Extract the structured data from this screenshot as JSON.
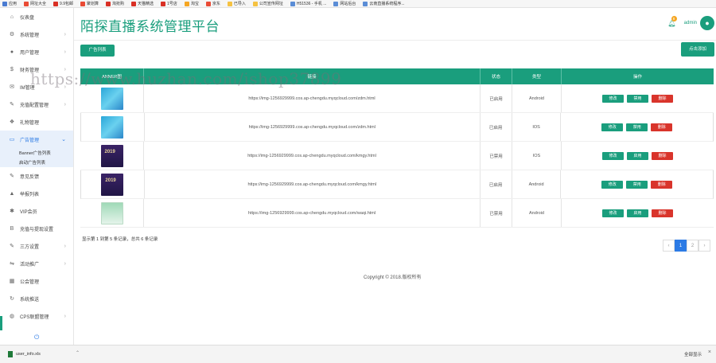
{
  "bookmarks": [
    {
      "label": "应用",
      "color": "#4a7bd1"
    },
    {
      "label": "网址大全",
      "color": "#e94b35"
    },
    {
      "label": "9.9包邮",
      "color": "#d93025"
    },
    {
      "label": "聚划算",
      "color": "#e94b35"
    },
    {
      "label": "淘抢购",
      "color": "#d93025"
    },
    {
      "label": "天猫精选",
      "color": "#d93025"
    },
    {
      "label": "1号店",
      "color": "#d93025"
    },
    {
      "label": "淘宝",
      "color": "#f5a623"
    },
    {
      "label": "京东",
      "color": "#e94b35"
    },
    {
      "label": "已导入",
      "color": "#f5c242"
    },
    {
      "label": "公司宣传网址",
      "color": "#f5c242"
    },
    {
      "label": "H51536 - 手机 ...",
      "color": "#5b8dd6"
    },
    {
      "label": "网站后台",
      "color": "#5b8dd6"
    },
    {
      "label": "云南直播系统程序...",
      "color": "#5b8dd6"
    }
  ],
  "sidebar": {
    "items": [
      {
        "label": "仪表盘",
        "icon": "home-icon",
        "glyph": "⌂",
        "chev": ""
      },
      {
        "label": "系统管理",
        "icon": "sliders-icon",
        "glyph": "⚙",
        "chev": "›"
      },
      {
        "label": "用户管理",
        "icon": "user-icon",
        "glyph": "●",
        "chev": "›"
      },
      {
        "label": "财务管理",
        "icon": "dollar-icon",
        "glyph": "$",
        "chev": "›"
      },
      {
        "label": "IM管理",
        "icon": "chat-icon",
        "glyph": "✉",
        "chev": "›"
      },
      {
        "label": "充值配置管理",
        "icon": "wrench-icon",
        "glyph": "✎",
        "chev": "›"
      },
      {
        "label": "礼物管理",
        "icon": "gift-icon",
        "glyph": "❖",
        "chev": ""
      },
      {
        "label": "广告管理",
        "icon": "monitor-icon",
        "glyph": "▭",
        "chev": "⌄",
        "active": true
      }
    ],
    "subitems": [
      "Banner广告列表",
      "启动广告列表"
    ],
    "items2": [
      {
        "label": "意见反馈",
        "icon": "edit-icon",
        "glyph": "✎",
        "chev": ""
      },
      {
        "label": "举报列表",
        "icon": "warning-icon",
        "glyph": "▲",
        "chev": ""
      },
      {
        "label": "VIP会员",
        "icon": "gear-icon",
        "glyph": "✱",
        "chev": ""
      },
      {
        "label": "充值与提现设置",
        "icon": "bold-icon",
        "glyph": "B",
        "chev": ""
      },
      {
        "label": "三方设置",
        "icon": "wrench-icon",
        "glyph": "✎",
        "chev": "›"
      },
      {
        "label": "活动推广",
        "icon": "share-icon",
        "glyph": "⇋",
        "chev": "›"
      },
      {
        "label": "公会管理",
        "icon": "grid-icon",
        "glyph": "▦",
        "chev": ""
      },
      {
        "label": "系统推送",
        "icon": "refresh-icon",
        "glyph": "↻",
        "chev": ""
      },
      {
        "label": "CPS联盟管理",
        "icon": "globe-icon",
        "glyph": "◍",
        "chev": "›"
      }
    ]
  },
  "header": {
    "title": "陌探直播系统管理平台",
    "notification_count": "8",
    "username": "admin"
  },
  "toolbar": {
    "list_label": "广告列表",
    "add_label": "点击添加"
  },
  "watermark": "https://www.huzhan.com/ishop37899",
  "table": {
    "headers": [
      "ANNER图",
      "链接",
      "状态",
      "类型",
      "操作"
    ],
    "rows": [
      {
        "thumb": "blue",
        "url": "https://img-1256929999.cos.ap-chengdu.myqcloud.com/zdm.html",
        "status": "已启用",
        "type": "Android",
        "ops": [
          "修改",
          "禁用",
          "删除"
        ]
      },
      {
        "thumb": "blue",
        "url": "https://img-1256929999.cos.ap-chengdu.myqcloud.com/zdm.html",
        "status": "已启用",
        "type": "IOS",
        "ops": [
          "修改",
          "禁用",
          "删除"
        ]
      },
      {
        "thumb": "purple",
        "url": "https://img-1256929999.cos.ap-chengdu.myqcloud.com/kmgy.html",
        "status": "已禁用",
        "type": "IOS",
        "ops": [
          "修改",
          "启用",
          "删除"
        ]
      },
      {
        "thumb": "purple",
        "url": "https://img-1256929999.cos.ap-chengdu.myqcloud.com/kmgy.html",
        "status": "已启用",
        "type": "Android",
        "ops": [
          "修改",
          "禁用",
          "删除"
        ]
      },
      {
        "thumb": "green",
        "url": "https://img-1256929999.cos.ap-chengdu.myqcloud.com/waqi.html",
        "status": "已禁用",
        "type": "Android",
        "ops": [
          "修改",
          "启用",
          "删除"
        ]
      }
    ]
  },
  "pagination": {
    "summary": "显示第 1 到第 5 条记录，总共 6 条记录",
    "prev": "‹",
    "pages": [
      "1",
      "2"
    ],
    "next": "›",
    "current": "1"
  },
  "footer": {
    "copyright": "Copyright © 2018.版权所有"
  },
  "download_bar": {
    "filename": "user_info.xls",
    "show_all": "全部显示",
    "close": "×"
  }
}
